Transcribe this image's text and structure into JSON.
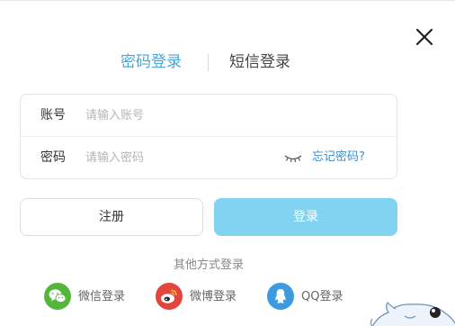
{
  "tabs": {
    "password_login": "密码登录",
    "sms_login": "短信登录"
  },
  "form": {
    "account_label": "账号",
    "account_placeholder": "请输入账号",
    "password_label": "密码",
    "password_placeholder": "请输入密码",
    "forgot_password": "忘记密码?"
  },
  "buttons": {
    "register": "注册",
    "login": "登录"
  },
  "other_login": {
    "title": "其他方式登录",
    "wechat": "微信登录",
    "weibo": "微博登录",
    "qq": "QQ登录"
  },
  "icons": {
    "close": "close-icon",
    "password_visibility": "eye-closed-icon",
    "wechat": "wechat-icon",
    "weibo": "weibo-icon",
    "qq": "qq-icon",
    "mascot": "mascot-illustration"
  },
  "colors": {
    "accent": "#4aa6d8",
    "link": "#3b8fd1",
    "login_button": "#80d4f2",
    "wechat": "#53b63b",
    "weibo": "#e2453c",
    "qq": "#3d9ae0"
  }
}
